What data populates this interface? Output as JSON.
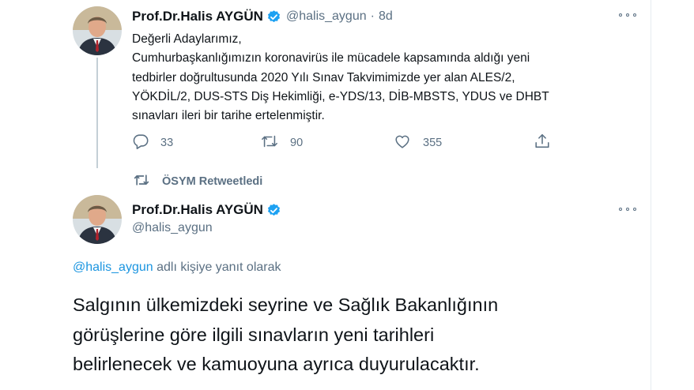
{
  "tweet1": {
    "author_name": "Prof.Dr.Halis AYGÜN",
    "handle": "@halis_aygun",
    "separator": "·",
    "time": "8d",
    "body_lines": [
      "Değerli Adaylarımız,",
      "Cumhurbaşkanlığımızın koronavirüs ile mücadele kapsamında aldığı yeni",
      "tedbirler doğrultusunda 2020 Yılı Sınav Takvimimizde yer alan ALES/2,",
      "YÖKDİL/2, DUS-STS Diş Hekimliği, e-YDS/13, DİB-MBSTS, YDUS ve DHBT",
      "sınavları ileri bir tarihe ertelenmiştir."
    ],
    "reply_count": "33",
    "retweet_count": "90",
    "like_count": "355"
  },
  "retweet_context": {
    "text": "ÖSYM Retweetledi"
  },
  "tweet2": {
    "author_name": "Prof.Dr.Halis AYGÜN",
    "handle": "@halis_aygun",
    "replying_link": "@halis_aygun",
    "replying_suffix": " adlı kişiye yanıt olarak",
    "body_lines": [
      "Salgının ülkemizdeki seyrine ve Sağlık Bakanlığının",
      "görüşlerine göre ilgili sınavların yeni tarihleri",
      "belirlenecek ve kamuoyuna ayrıca duyurulacaktır."
    ]
  },
  "colors": {
    "accent": "#1da1f2",
    "link": "#1b95e0",
    "muted": "#5b7083",
    "text": "#0f1419"
  },
  "icons": [
    "reply-icon",
    "retweet-icon",
    "like-icon",
    "share-icon",
    "verified-badge-icon",
    "more-icon"
  ]
}
